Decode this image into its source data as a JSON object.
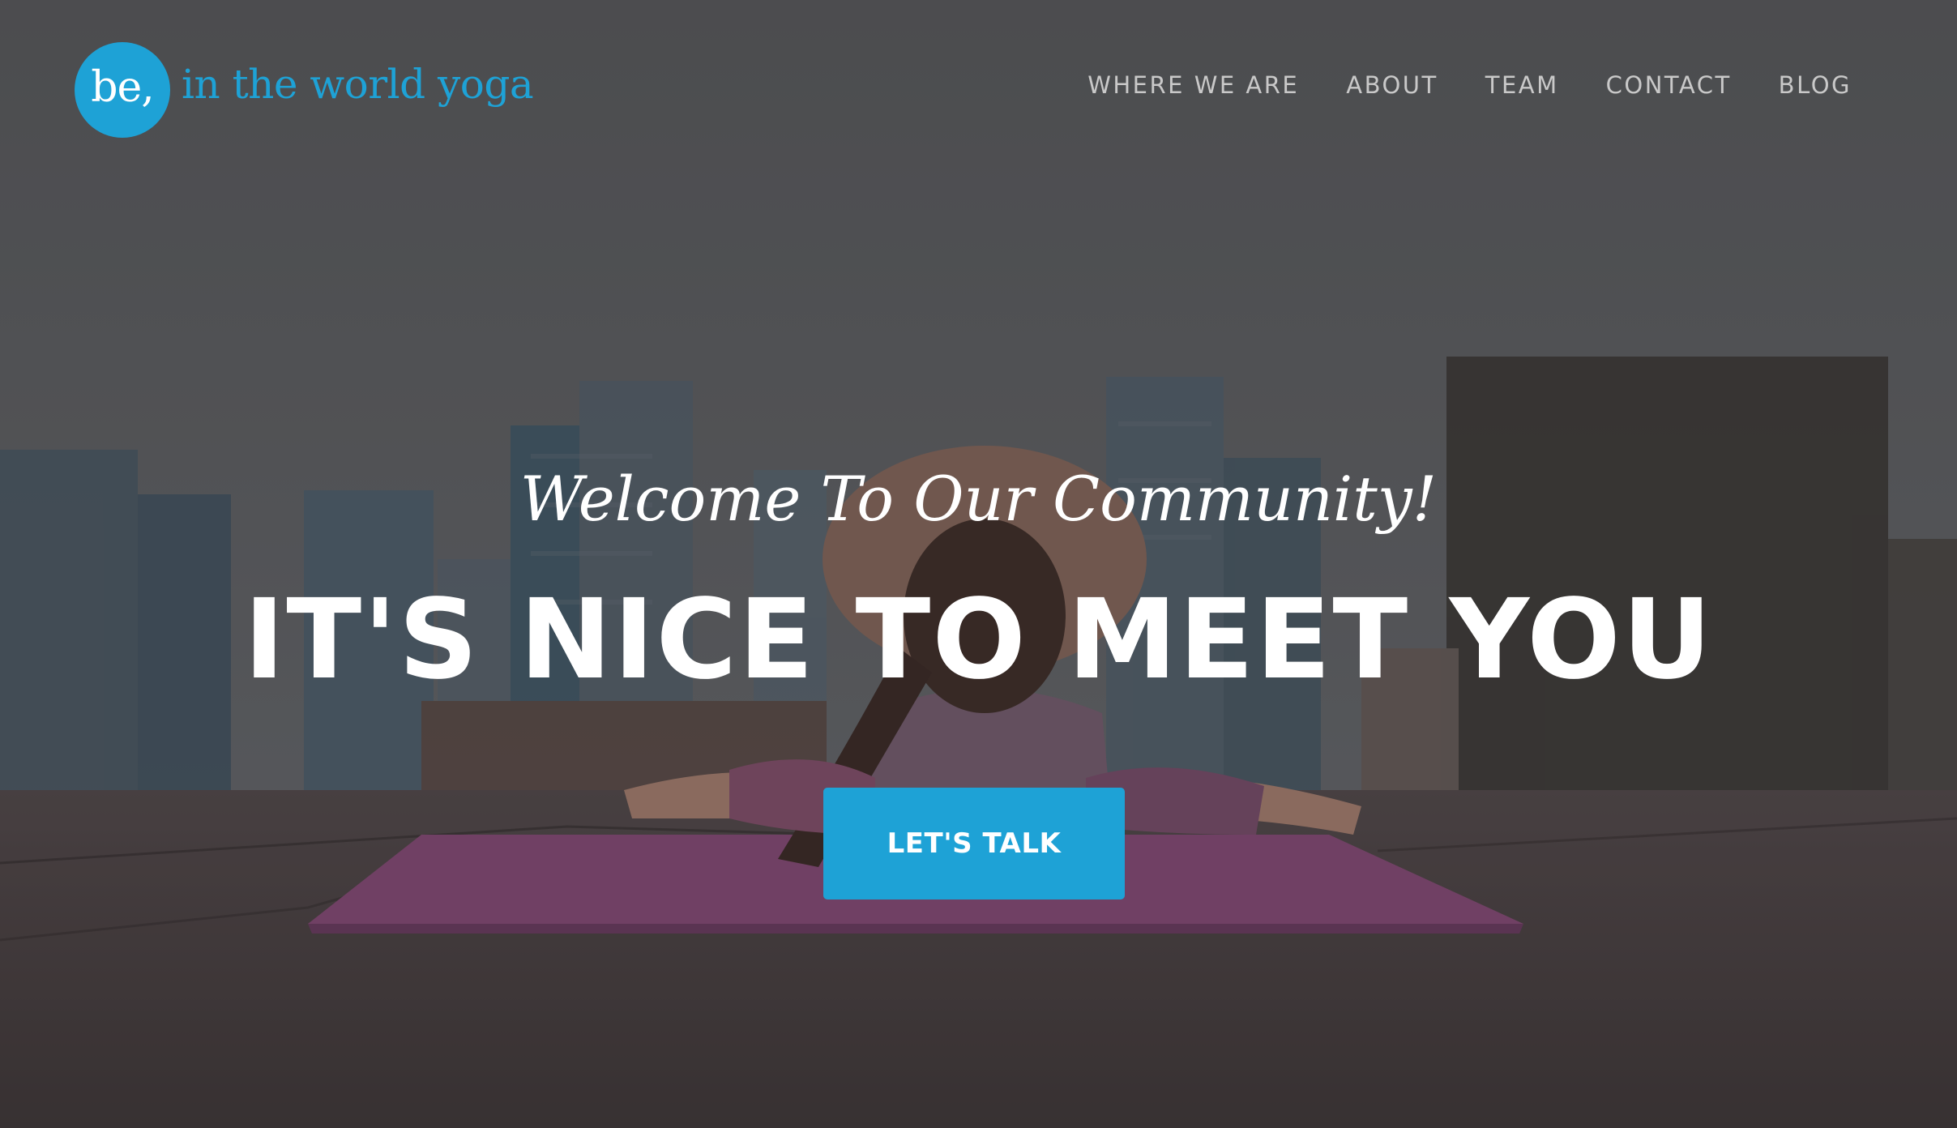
{
  "brand": {
    "badge_text": "be,",
    "name": "in the world yoga",
    "accent_color": "#1ea2d6"
  },
  "nav": {
    "items": [
      {
        "label": "WHERE WE ARE"
      },
      {
        "label": "ABOUT"
      },
      {
        "label": "TEAM"
      },
      {
        "label": "CONTACT"
      },
      {
        "label": "BLOG"
      }
    ]
  },
  "hero": {
    "subheading": "Welcome To Our Community!",
    "heading": "IT'S NICE TO MEET YOU",
    "cta_label": "LET'S TALK",
    "background_image": "woman-stretching-on-yoga-mat-rooftop-city-skyline-photo"
  }
}
